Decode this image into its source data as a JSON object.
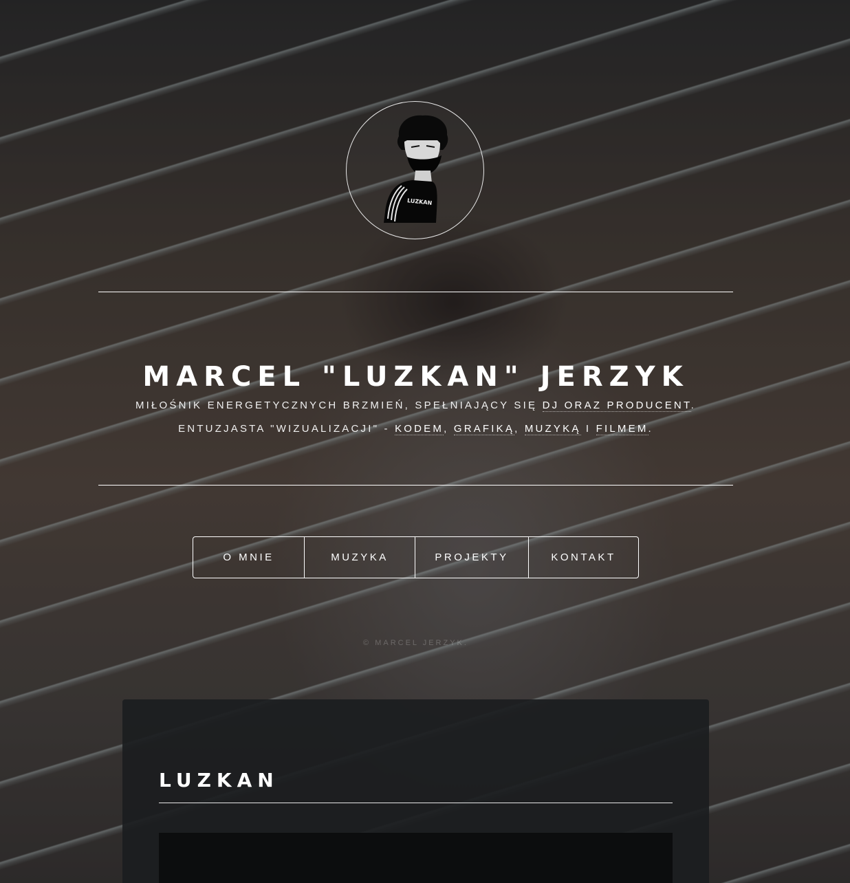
{
  "header": {
    "logo": {
      "alt": "Luzkan avatar logo",
      "shirt_text": "LUZKAN"
    },
    "title": "MARCEL \"LUZKAN\" JERZYK",
    "intro_line1": {
      "prefix": "MIŁOŚNIK ENERGETYCZNYCH BRZMIEŃ, SPEŁNIAJĄCY SIĘ ",
      "link": "DJ ORAZ PRODUCENT",
      "suffix": "."
    },
    "intro_line2": {
      "prefix": "ENTUZJASTA \"WIZUALIZACJI\" - ",
      "link_code": "KODEM",
      "sep1": ", ",
      "link_graphics": "GRAFIKĄ",
      "sep2": ", ",
      "link_music": "MUZYKĄ",
      "sep3": " I ",
      "link_film": "FILMEM",
      "suffix": "."
    }
  },
  "nav": {
    "items": [
      {
        "label": "O MNIE"
      },
      {
        "label": "MUZYKA"
      },
      {
        "label": "PROJEKTY"
      },
      {
        "label": "KONTAKT"
      }
    ]
  },
  "footer": {
    "copyright": "© MARCEL JERZYK."
  },
  "article": {
    "title": "LUZKAN"
  },
  "colors": {
    "text": "#ffffff",
    "panel_bg": "#1b1d20",
    "media_bg": "#0c0d0e"
  }
}
